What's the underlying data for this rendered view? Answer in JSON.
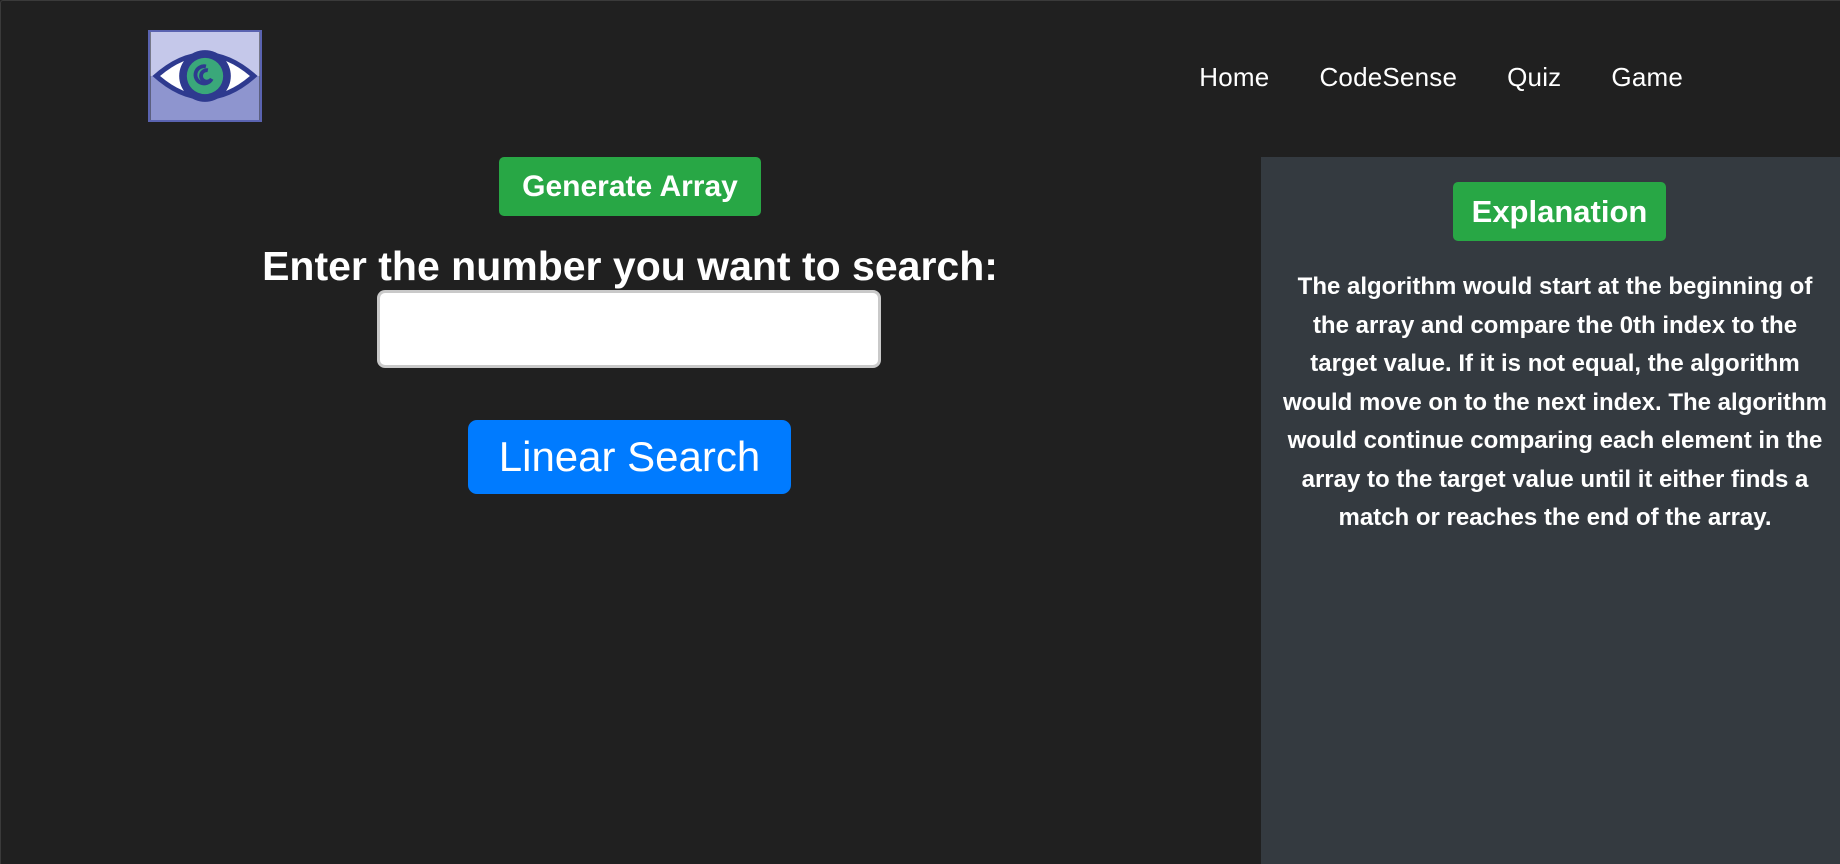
{
  "navbar": {
    "logo_icon": "eye-logo",
    "links": [
      {
        "label": "Home"
      },
      {
        "label": "CodeSense"
      },
      {
        "label": "Quiz"
      },
      {
        "label": "Game"
      }
    ]
  },
  "main": {
    "generate_label": "Generate Array",
    "prompt": "Enter the number you want to search:",
    "search_value": "",
    "search_label": "Linear Search"
  },
  "explanation": {
    "button_label": "Explanation",
    "text": "The algorithm would start at the beginning of the array and compare the 0th index to the target value. If it is not equal, the algorithm would move on to the next index. The algorithm would continue comparing each element in the array to the target value until it either finds a match or reaches the end of the array."
  },
  "colors": {
    "background": "#202020",
    "panel": "#343a40",
    "green_button": "#28a745",
    "blue_button": "#007bff"
  }
}
